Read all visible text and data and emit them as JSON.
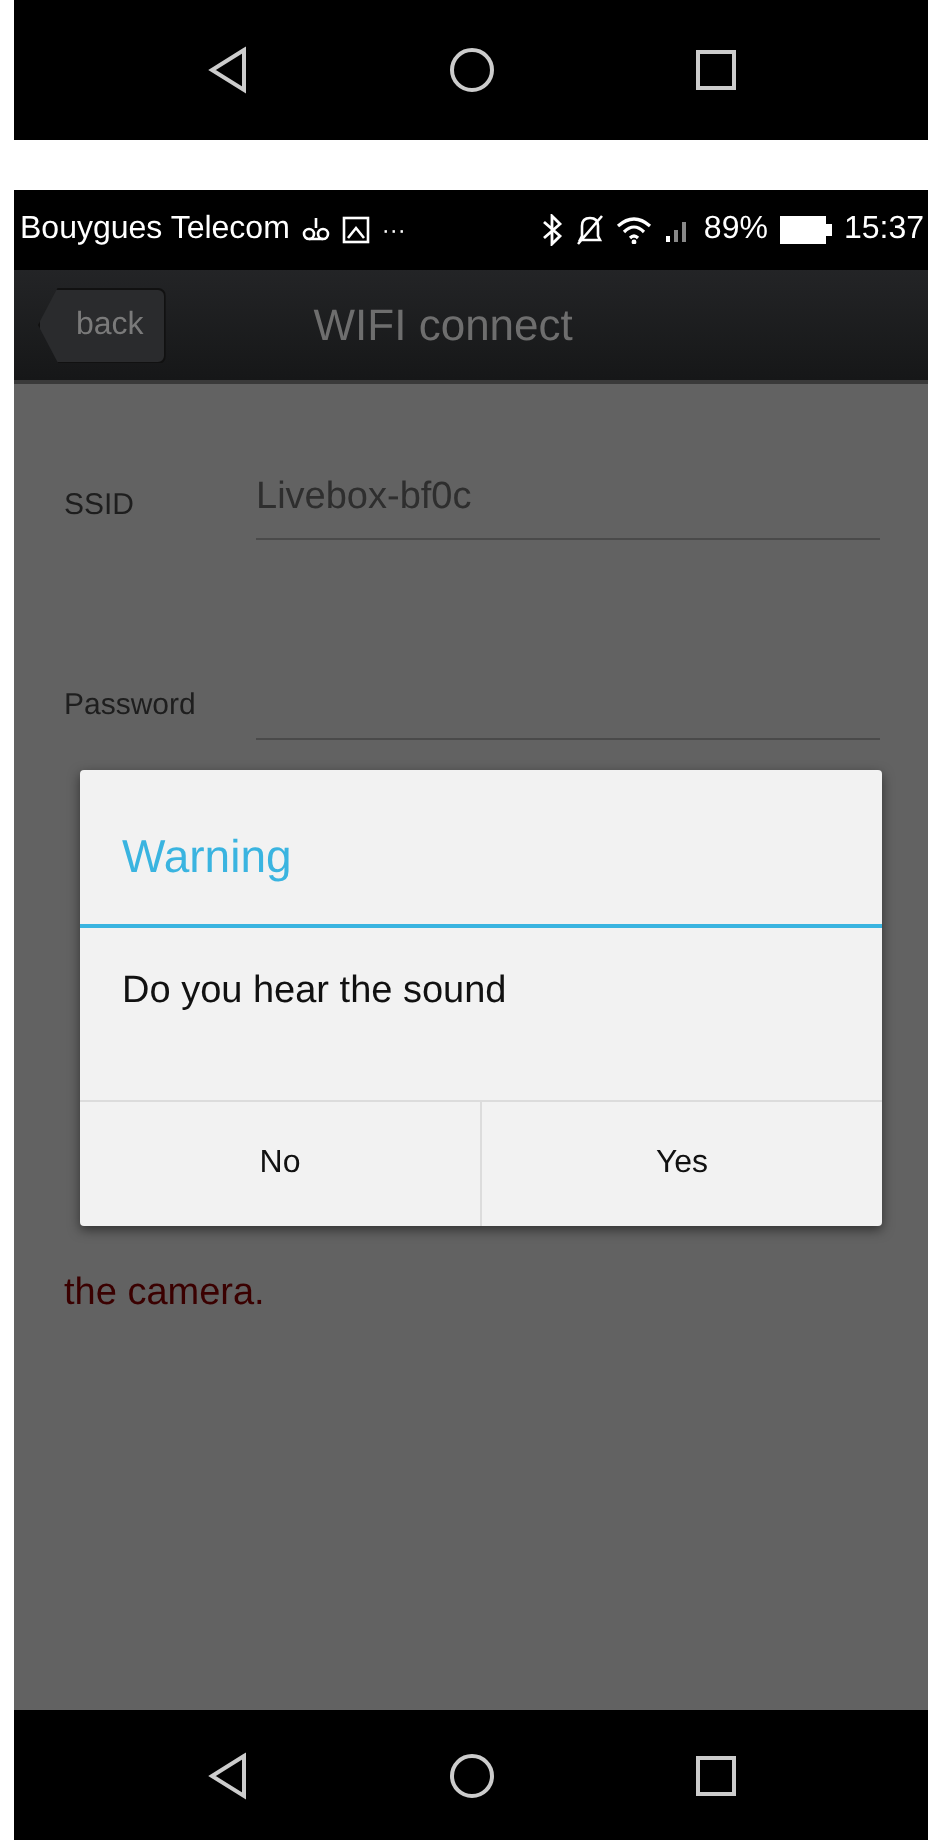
{
  "status_bar": {
    "carrier": "Bouygues Telecom",
    "more": "···",
    "battery": "89%",
    "time": "15:37"
  },
  "title_bar": {
    "back": "back",
    "title": "WIFI connect"
  },
  "form": [
    {
      "label": "SSID",
      "placeholder": "Livebox-bf0c"
    },
    {
      "label": "Password"
    }
  ],
  "hint_lines": [
    "the camera."
  ],
  "dialog": {
    "title": "Warning",
    "message": "Do you hear the sound",
    "buttons": [
      "No",
      "Yes"
    ]
  }
}
